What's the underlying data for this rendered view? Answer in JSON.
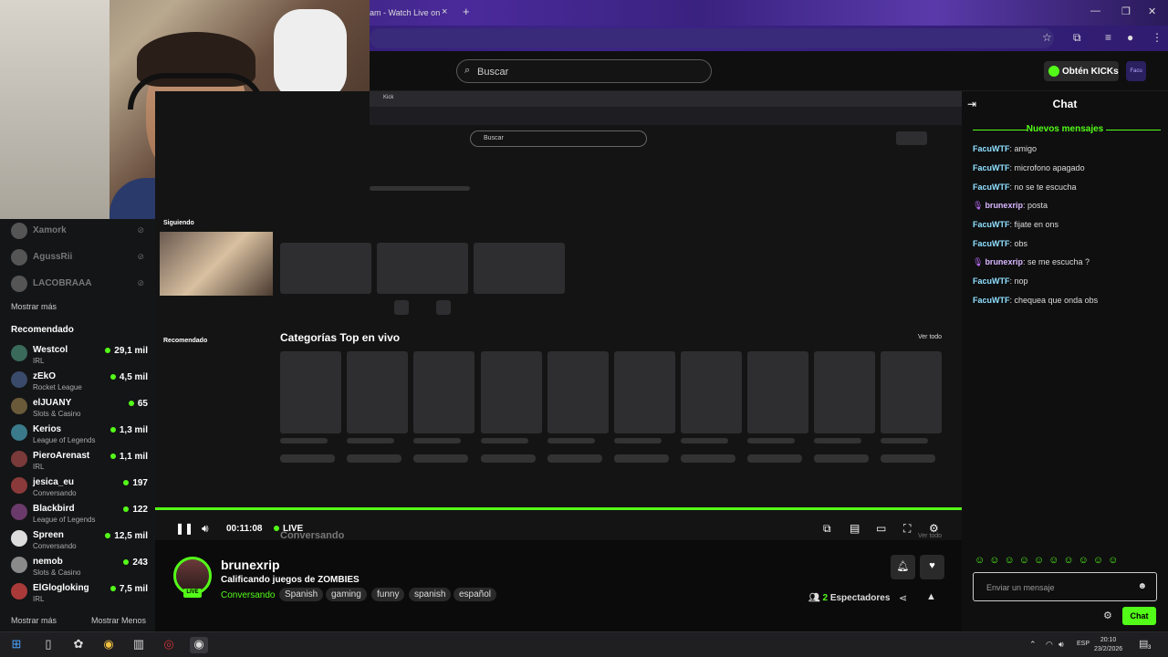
{
  "browser": {
    "tab_title": "am - Watch Live on",
    "tab_close": "×",
    "new_tab": "+"
  },
  "header": {
    "search_placeholder": "Buscar",
    "kicks_label": "Obtén KICKs",
    "user_badge": "Facu"
  },
  "sidebar": {
    "offline": [
      {
        "name": "Xamork"
      },
      {
        "name": "AgussRii"
      },
      {
        "name": "LACOBRAAA"
      }
    ],
    "show_more": "Mostrar más",
    "recommended_title": "Recomendado",
    "channels": [
      {
        "name": "Westcol",
        "category": "IRL",
        "viewers": "29,1 mil"
      },
      {
        "name": "zEkO",
        "category": "Rocket League",
        "viewers": "4,5 mil"
      },
      {
        "name": "elJUANY",
        "category": "Slots & Casino",
        "viewers": "65"
      },
      {
        "name": "Kerios",
        "category": "League of Legends",
        "viewers": "1,3 mil"
      },
      {
        "name": "PieroArenast",
        "category": "IRL",
        "viewers": "1,1 mil"
      },
      {
        "name": "jesica_eu",
        "category": "Conversando",
        "viewers": "197"
      },
      {
        "name": "Blackbird",
        "category": "League of Legends",
        "viewers": "122"
      },
      {
        "name": "Spreen",
        "category": "Conversando",
        "viewers": "12,5 mil"
      },
      {
        "name": "nemob",
        "category": "Slots & Casino",
        "viewers": "243"
      },
      {
        "name": "ElGlogloking",
        "category": "IRL",
        "viewers": "7,5 mil"
      }
    ],
    "show_more_bottom": "Mostrar más",
    "show_less": "Mostrar Menos"
  },
  "video": {
    "inner_tab": "Kick",
    "inner_search": "Buscar",
    "following": "Siguiendo",
    "recommended": "Recomendado",
    "top_categories": "Categorías Top en vivo",
    "see_all": "Ver todo",
    "time": "00:11:08",
    "live": "LIVE",
    "overlay_category": "Conversando",
    "overlay_see_all": "Ver todo"
  },
  "stream": {
    "channel": "brunexrip",
    "title": "Calificando juegos de ZOMBIES",
    "category": "Conversando",
    "tags": [
      "Spanish",
      "gaming",
      "funny",
      "spanish",
      "español"
    ],
    "live_badge": "LIVE",
    "viewers": "2",
    "viewers_label": "Espectadores"
  },
  "chat": {
    "title": "Chat",
    "new_messages": "Nuevos mensajes",
    "messages": [
      {
        "user": "FacuWTF",
        "text": "amigo",
        "badge": false
      },
      {
        "user": "FacuWTF",
        "text": "microfono apagado",
        "badge": false
      },
      {
        "user": "FacuWTF",
        "text": "no se te escucha",
        "badge": false
      },
      {
        "user": "brunexrip",
        "text": "posta",
        "badge": true
      },
      {
        "user": "FacuWTF",
        "text": "fijate en ons",
        "badge": false
      },
      {
        "user": "FacuWTF",
        "text": "obs",
        "badge": false
      },
      {
        "user": "brunexrip",
        "text": "se me escucha ?",
        "badge": true
      },
      {
        "user": "FacuWTF",
        "text": "nop",
        "badge": false
      },
      {
        "user": "FacuWTF",
        "text": "chequea que onda obs",
        "badge": false
      }
    ],
    "input_placeholder": "Enviar un mensaje",
    "send_label": "Chat"
  },
  "taskbar": {
    "language": "ESP",
    "time": "20:10",
    "date": "23/2/2026",
    "notifications": "3"
  },
  "colors": {
    "accent": "#53fc18"
  }
}
